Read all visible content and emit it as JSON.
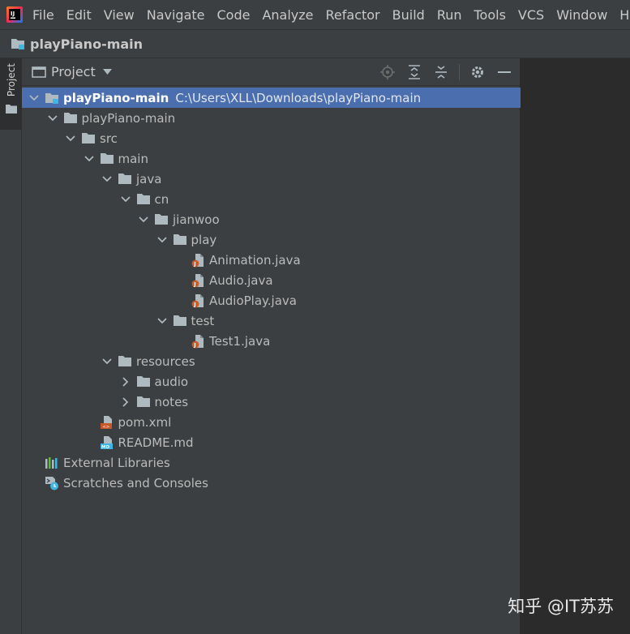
{
  "menubar": {
    "logo_icon": "intellij-idea-logo-icon",
    "items": [
      "File",
      "Edit",
      "View",
      "Navigate",
      "Code",
      "Analyze",
      "Refactor",
      "Build",
      "Run",
      "Tools",
      "VCS",
      "Window",
      "Help"
    ]
  },
  "navbar": {
    "project_name": "playPiano-main"
  },
  "side_strip": {
    "tab_label": "Project"
  },
  "panel": {
    "title": "Project"
  },
  "tree": {
    "nodes": [
      {
        "label": "playPiano-main",
        "path": "C:\\Users\\XLL\\Downloads\\playPiano-main",
        "type": "project-root",
        "expanded": true,
        "selected": true,
        "depth": 0
      },
      {
        "label": "playPiano-main",
        "type": "folder",
        "expanded": true,
        "depth": 1
      },
      {
        "label": "src",
        "type": "folder",
        "expanded": true,
        "depth": 2
      },
      {
        "label": "main",
        "type": "folder",
        "expanded": true,
        "depth": 3
      },
      {
        "label": "java",
        "type": "folder",
        "expanded": true,
        "depth": 4
      },
      {
        "label": "cn",
        "type": "folder",
        "expanded": true,
        "depth": 5
      },
      {
        "label": "jianwoo",
        "type": "folder",
        "expanded": true,
        "depth": 6
      },
      {
        "label": "play",
        "type": "folder",
        "expanded": true,
        "depth": 7
      },
      {
        "label": "Animation.java",
        "type": "java-file",
        "depth": 8
      },
      {
        "label": "Audio.java",
        "type": "java-file",
        "depth": 8
      },
      {
        "label": "AudioPlay.java",
        "type": "java-file",
        "depth": 8
      },
      {
        "label": "test",
        "type": "folder",
        "expanded": true,
        "depth": 7
      },
      {
        "label": "Test1.java",
        "type": "java-file",
        "depth": 8
      },
      {
        "label": "resources",
        "type": "folder",
        "expanded": true,
        "depth": 4
      },
      {
        "label": "audio",
        "type": "folder",
        "expanded": false,
        "depth": 5
      },
      {
        "label": "notes",
        "type": "folder",
        "expanded": false,
        "depth": 5
      },
      {
        "label": "pom.xml",
        "type": "xml-file",
        "depth": 3
      },
      {
        "label": "README.md",
        "type": "md-file",
        "depth": 3
      },
      {
        "label": "External Libraries",
        "type": "libraries",
        "depth": 0
      },
      {
        "label": "Scratches and Consoles",
        "type": "scratches",
        "depth": 0
      }
    ]
  },
  "watermark": "知乎 @IT苏苏",
  "colors": {
    "selection": "#4b6eaf",
    "panel_bg": "#3c3f41",
    "editor_bg": "#2b2b2b",
    "folder": "#aeb9c0",
    "java_badge": "#c75e2b",
    "xml_badge": "#c9572a",
    "md_badge": "#40b6e0"
  }
}
